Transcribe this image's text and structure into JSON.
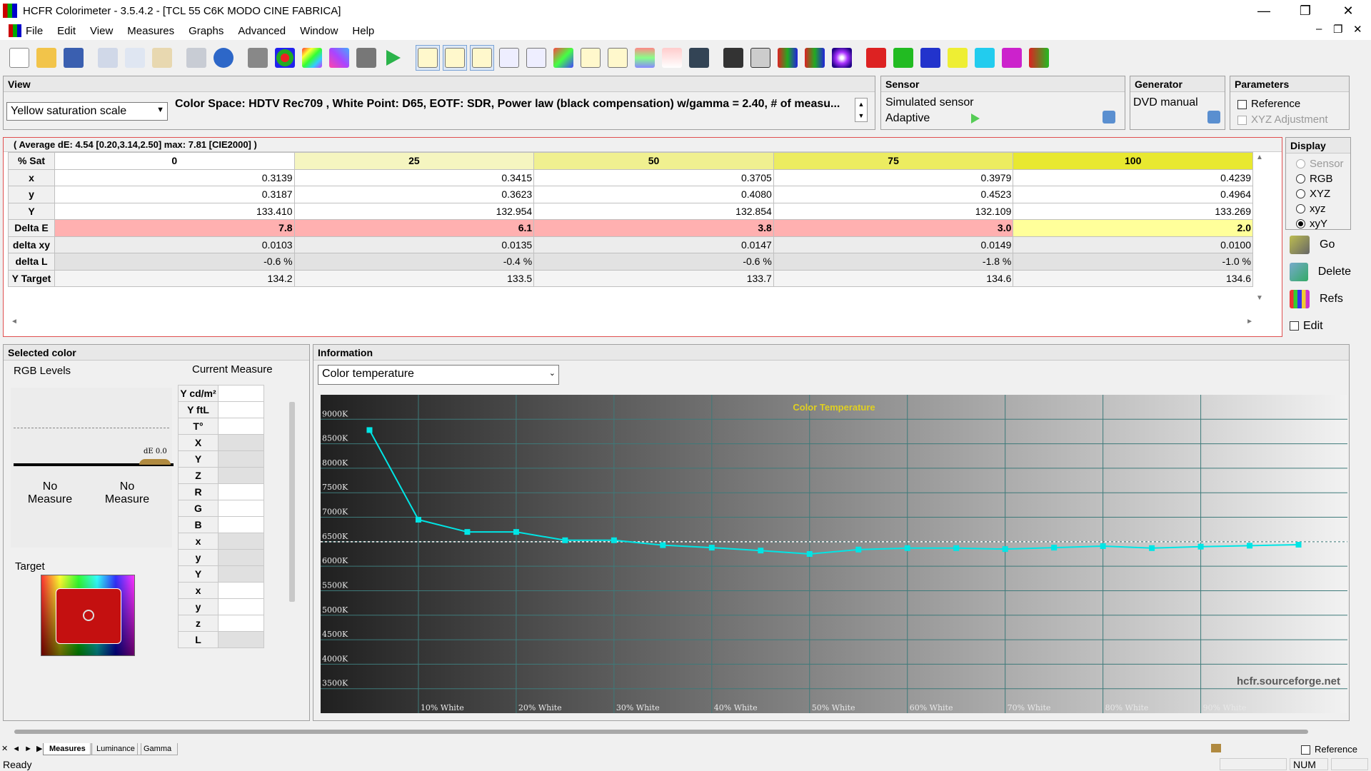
{
  "window": {
    "title": "HCFR Colorimeter - 3.5.4.2 - [TCL 55 C6K MODO CINE FABRICA]",
    "minimize": "—",
    "maximize": "❐",
    "close": "✕"
  },
  "menu": [
    "File",
    "Edit",
    "View",
    "Measures",
    "Graphs",
    "Advanced",
    "Window",
    "Help"
  ],
  "view_panel": {
    "header": "View",
    "combo_value": "Yellow saturation scale",
    "description": "Color Space: HDTV Rec709 , White Point: D65, EOTF:  SDR, Power law (black compensation) w/gamma = 2.40, # of measu..."
  },
  "sensor_panel": {
    "header": "Sensor",
    "name": "Simulated sensor",
    "mode": "Adaptive"
  },
  "generator_panel": {
    "header": "Generator",
    "name": "DVD manual"
  },
  "parameters_panel": {
    "header": "Parameters",
    "reference": "Reference",
    "xyz_adjustment": "XYZ Adjustment"
  },
  "measures_grid": {
    "summary": "( Average dE: 4.54 [0.20,3.14,2.50] max: 7.81 [CIE2000] )",
    "corner": "% Sat",
    "columns": [
      "0",
      "25",
      "50",
      "75",
      "100"
    ],
    "column_colors": [
      "#ffffff",
      "#f5f5c0",
      "#f0f090",
      "#ecec60",
      "#e8e830"
    ],
    "rows": [
      {
        "label": "x",
        "values": [
          "0.3139",
          "0.3415",
          "0.3705",
          "0.3979",
          "0.4239"
        ]
      },
      {
        "label": "y",
        "values": [
          "0.3187",
          "0.3623",
          "0.4080",
          "0.4523",
          "0.4964"
        ]
      },
      {
        "label": "Y",
        "values": [
          "133.410",
          "132.954",
          "132.854",
          "132.109",
          "133.269"
        ]
      },
      {
        "label": "Delta E",
        "values": [
          "7.8",
          "6.1",
          "3.8",
          "3.0",
          "2.0"
        ]
      },
      {
        "label": "delta xy",
        "values": [
          "0.0103",
          "0.0135",
          "0.0147",
          "0.0149",
          "0.0100"
        ]
      },
      {
        "label": "delta L",
        "values": [
          "-0.6 %",
          "-0.4 %",
          "-0.6 %",
          "-1.8 %",
          "-1.0 %"
        ]
      },
      {
        "label": "Y Target",
        "values": [
          "134.2",
          "133.5",
          "133.7",
          "134.6",
          "134.6"
        ]
      }
    ],
    "delta_e_colors": [
      "#ffb0b0",
      "#ffb0b0",
      "#ffb0b0",
      "#ffb0b0",
      "#ffff9a"
    ]
  },
  "display_panel": {
    "header": "Display",
    "options": [
      "Sensor",
      "RGB",
      "XYZ",
      "xyz",
      "xyY"
    ],
    "selected": "xyY"
  },
  "actions": {
    "go": "Go",
    "delete": "Delete",
    "refs": "Refs",
    "edit": "Edit"
  },
  "selected_color": {
    "header": "Selected color",
    "rgb_levels": "RGB Levels",
    "current_measure": "Current Measure",
    "de_label": "dE 0.0",
    "no_measure_1": "No Measure",
    "no_measure_2": "No Measure",
    "target": "Target",
    "table_labels": [
      "Y cd/m²",
      "Y ftL",
      "T°",
      "X",
      "Y",
      "Z",
      "R",
      "G",
      "B",
      "x",
      "y",
      "Y",
      "x",
      "y",
      "z",
      "L"
    ]
  },
  "information": {
    "header": "Information",
    "combo_value": "Color temperature",
    "watermark": "hcfr.sourceforge.net"
  },
  "chart_data": {
    "type": "line",
    "title": "Color Temperature",
    "ylim": [
      3000,
      9500
    ],
    "yticks": [
      "9000K",
      "8500K",
      "8000K",
      "7500K",
      "7000K",
      "6500K",
      "6000K",
      "5500K",
      "5000K",
      "4500K",
      "4000K",
      "3500K"
    ],
    "xticks": [
      "10% White",
      "20% White",
      "30% White",
      "40% White",
      "50% White",
      "60% White",
      "70% White",
      "80% White",
      "90% White"
    ],
    "x": [
      5,
      10,
      15,
      20,
      25,
      30,
      35,
      40,
      45,
      50,
      55,
      60,
      65,
      70,
      75,
      80,
      85,
      90,
      95,
      100
    ],
    "series": [
      {
        "values": [
          8780,
          6950,
          6700,
          6700,
          6530,
          6530,
          6430,
          6380,
          6320,
          6250,
          6340,
          6370,
          6370,
          6350,
          6380,
          6410,
          6370,
          6400,
          6420,
          6440
        ]
      }
    ],
    "reference": 6500,
    "line_color": "#00e5e5"
  },
  "tabs": [
    "Measures",
    "Luminance",
    "Gamma"
  ],
  "status": {
    "left": "Ready",
    "num": "NUM",
    "reference": "Reference"
  }
}
